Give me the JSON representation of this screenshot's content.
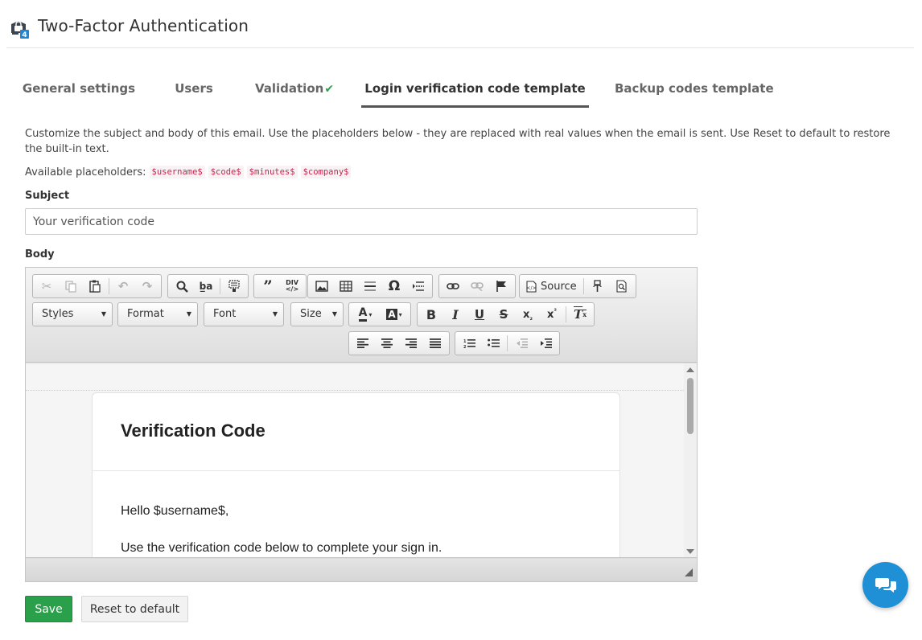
{
  "header": {
    "title": "Two-Factor Authentication",
    "icon": "lock-shield-icon"
  },
  "tabs": [
    {
      "label": "General settings",
      "active": false
    },
    {
      "label": "Users",
      "active": false
    },
    {
      "label": "Validation",
      "active": false,
      "badge": "✔"
    },
    {
      "label": "Login verification code template",
      "active": true
    },
    {
      "label": "Backup codes template",
      "active": false
    }
  ],
  "description": "Customize the subject and body of this email. Use the placeholders below - they are replaced with real values when the email is sent. Use Reset to default to restore the built-in text.",
  "placeholders": {
    "label": "Available placeholders:",
    "items": [
      "$username$",
      "$code$",
      "$minutes$",
      "$company$"
    ]
  },
  "subject": {
    "label": "Subject",
    "value": "Your verification code"
  },
  "body": {
    "label": "Body"
  },
  "editor": {
    "combos": {
      "styles": "Styles",
      "format": "Format",
      "font": "Font",
      "size": "Size"
    },
    "source_label": "Source",
    "content": {
      "heading": "Verification Code",
      "greeting": "Hello $username$,",
      "line1": "Use the verification code below to complete your sign in."
    }
  },
  "actions": {
    "save": "Save",
    "reset": "Reset to default"
  },
  "colors": {
    "save": "#2aa04a",
    "chat": "#1f8fd6",
    "placeholder_text": "#c7254e",
    "check": "#2e9e4a"
  }
}
